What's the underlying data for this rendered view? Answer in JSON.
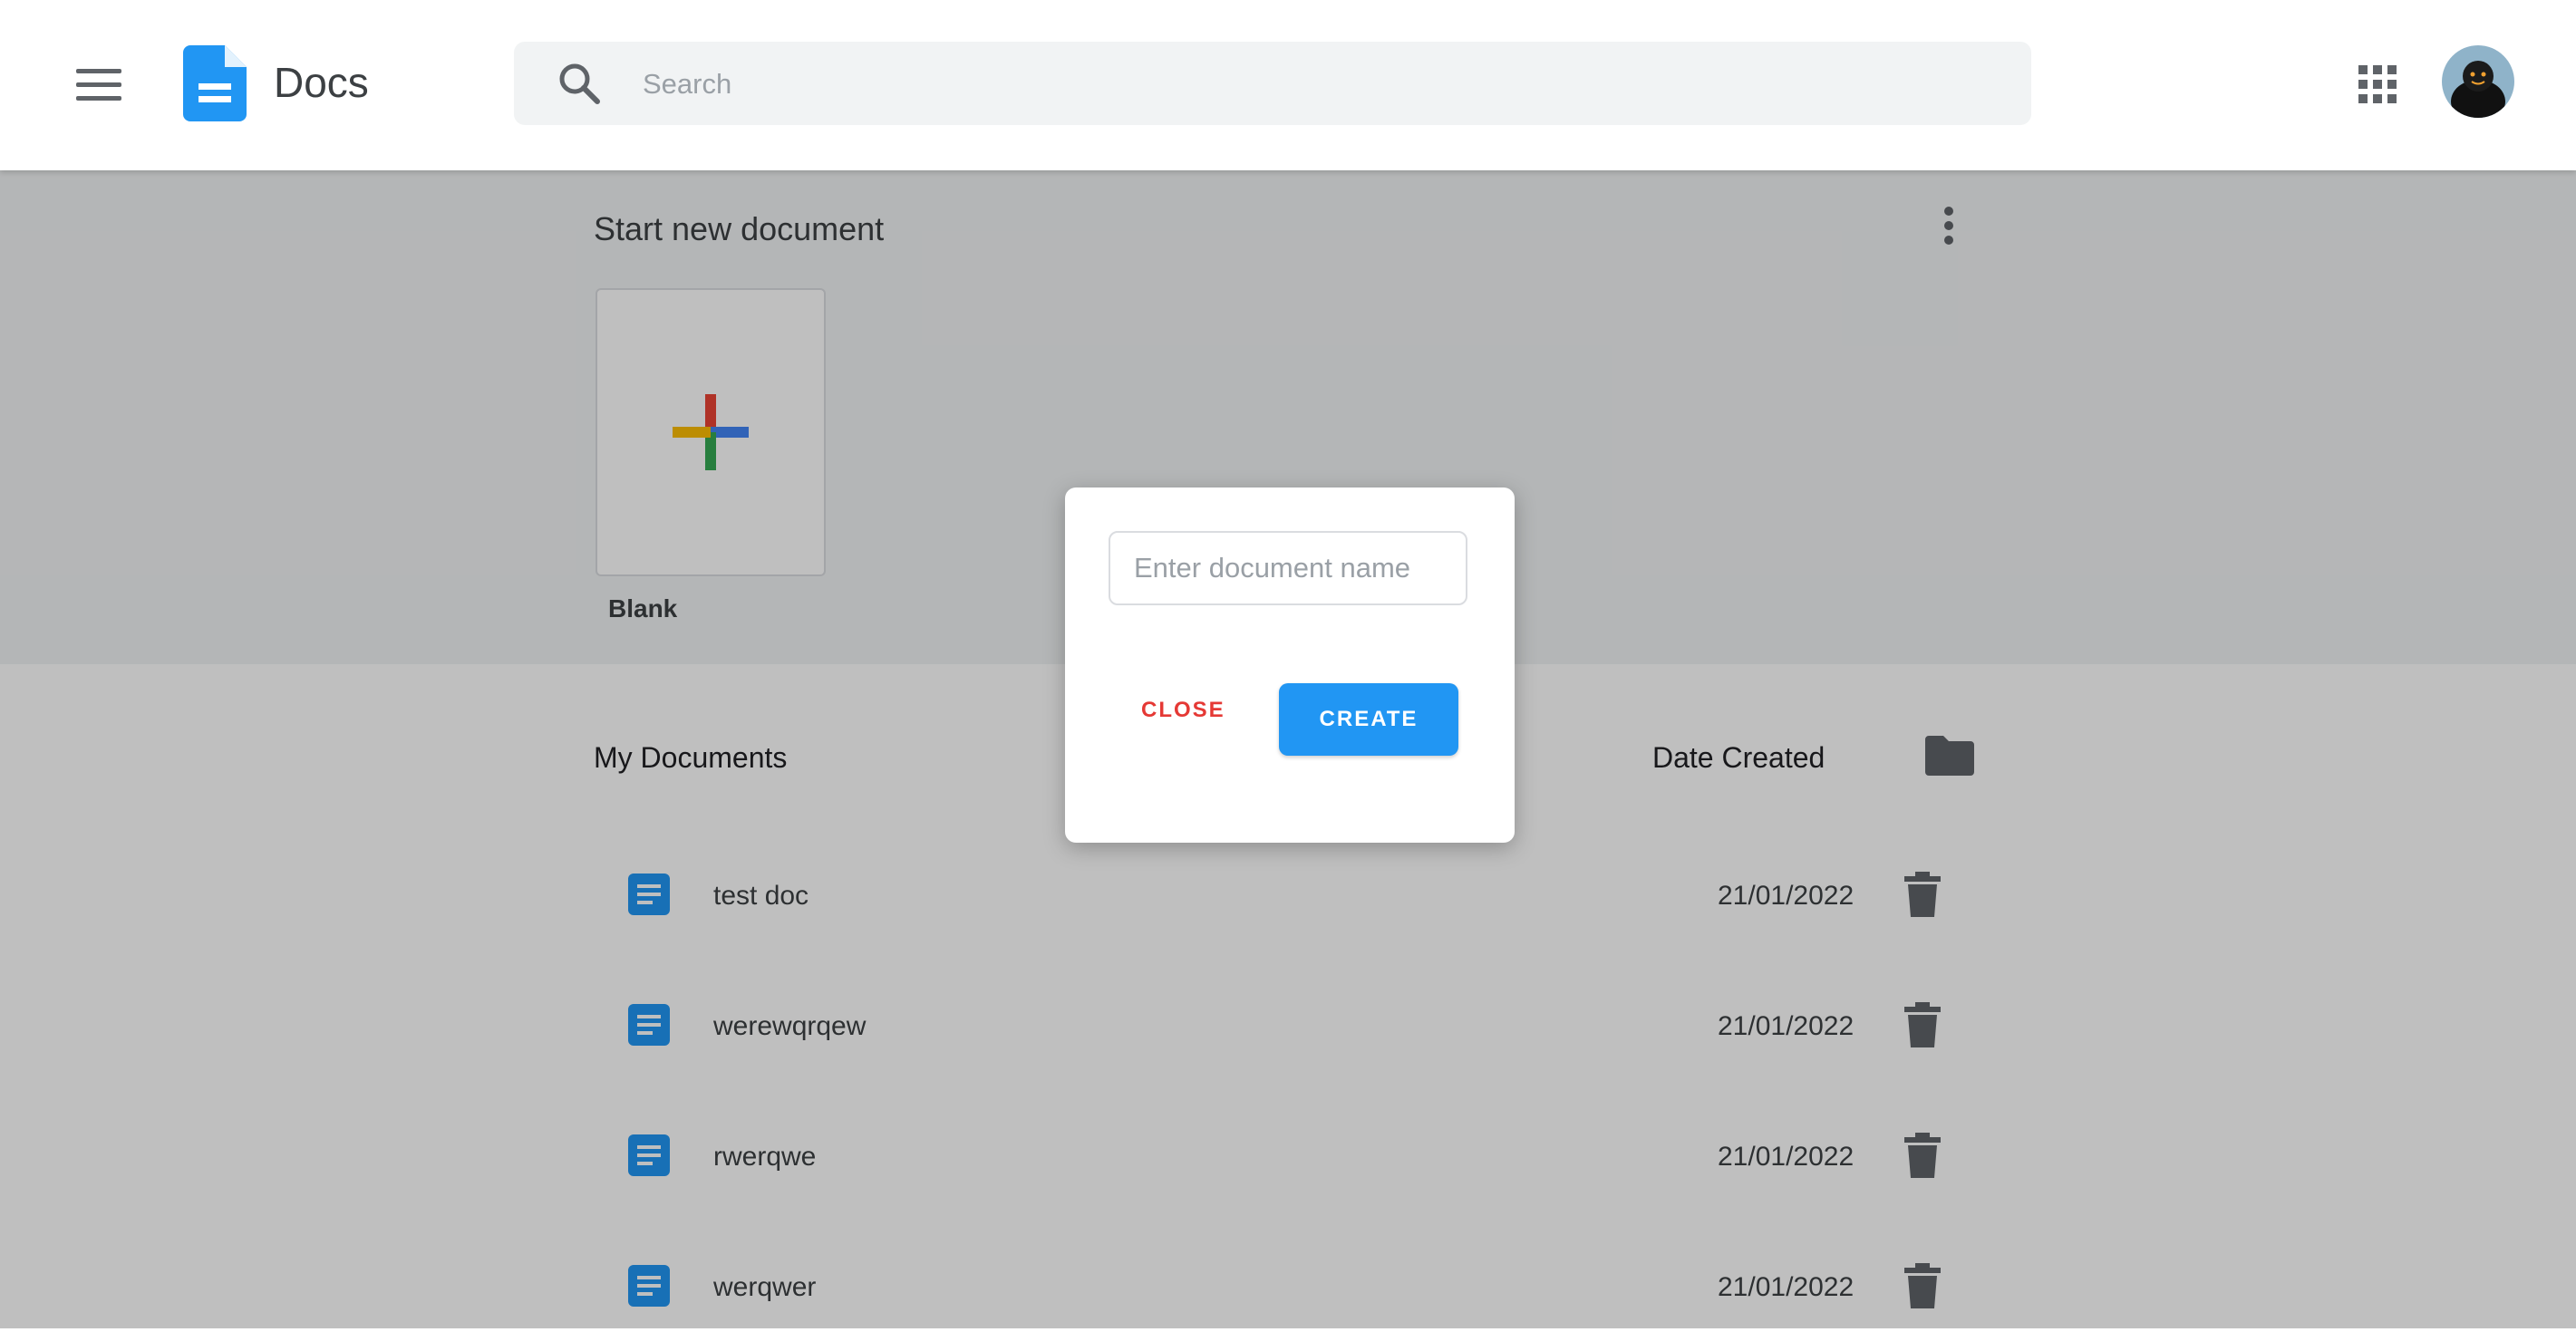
{
  "app": {
    "title": "Docs",
    "brand_color": "#2196f3"
  },
  "search": {
    "placeholder": "Search",
    "value": ""
  },
  "start_section": {
    "title": "Start new document",
    "blank_label": "Blank"
  },
  "my_documents": {
    "title": "My Documents",
    "date_header": "Date Created",
    "documents": [
      {
        "name": "test doc",
        "date": "21/01/2022"
      },
      {
        "name": "werewqrqew",
        "date": "21/01/2022"
      },
      {
        "name": "rwerqwe",
        "date": "21/01/2022"
      },
      {
        "name": "werqwer",
        "date": "21/01/2022"
      }
    ]
  },
  "modal": {
    "input_placeholder": "Enter document name",
    "input_value": "",
    "close_label": "CLOSE",
    "create_label": "CREATE",
    "close_color": "#e53935",
    "create_color": "#2196f3"
  },
  "icons": {
    "menu": "hamburger-menu-icon",
    "logo": "docs-logo-icon",
    "search": "search-icon",
    "apps": "apps-grid-icon",
    "more": "more-vert-icon",
    "plus": "plus-icon",
    "folder": "folder-icon",
    "document": "document-icon",
    "trash": "trash-icon"
  }
}
